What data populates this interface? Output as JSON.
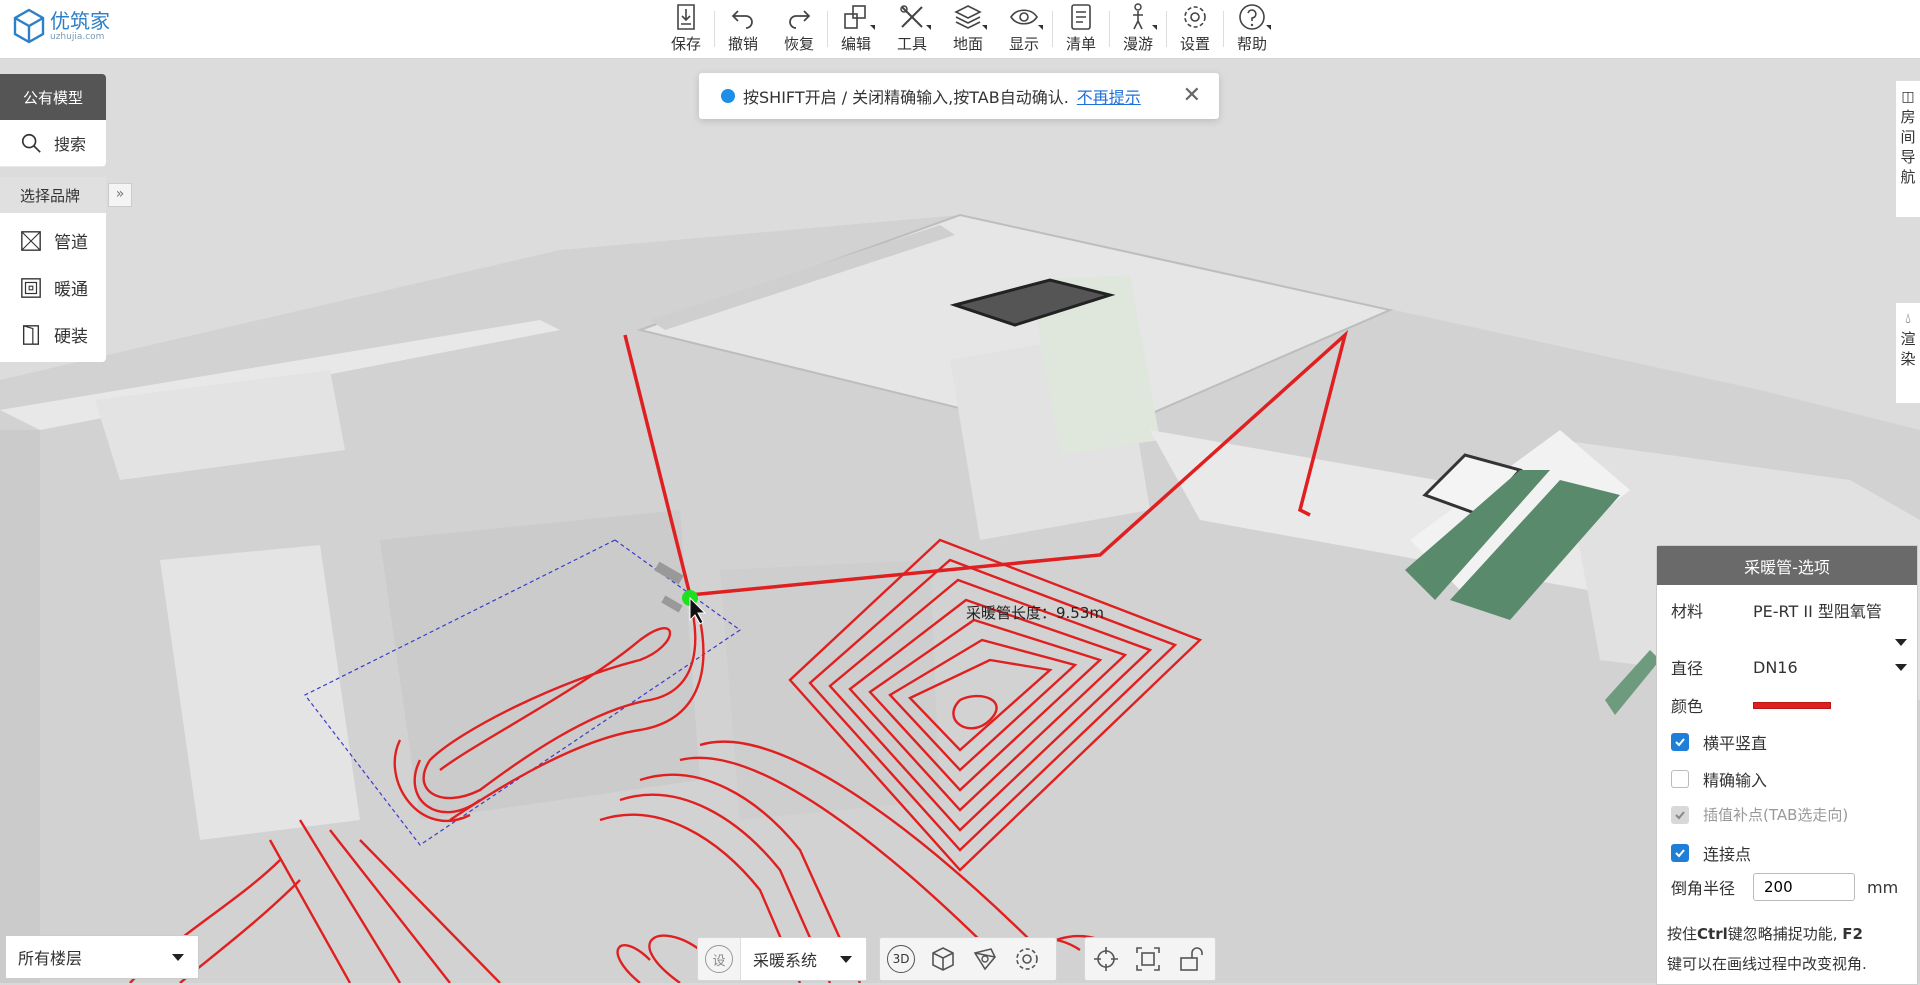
{
  "app": {
    "logo_name": "优筑家",
    "logo_domain": "uzhujia.com"
  },
  "toolbar": {
    "items": [
      {
        "label": "保存",
        "icon": "save-icon",
        "has_menu": false
      },
      {
        "label": "撤销",
        "icon": "undo-icon",
        "has_menu": false
      },
      {
        "label": "恢复",
        "icon": "redo-icon",
        "has_menu": false
      },
      {
        "label": "编辑",
        "icon": "edit-icon",
        "has_menu": true
      },
      {
        "label": "工具",
        "icon": "tools-icon",
        "has_menu": true
      },
      {
        "label": "地面",
        "icon": "layers-icon",
        "has_menu": true
      },
      {
        "label": "显示",
        "icon": "eye-icon",
        "has_menu": true
      },
      {
        "label": "清单",
        "icon": "list-icon",
        "has_menu": false
      },
      {
        "label": "漫游",
        "icon": "walk-icon",
        "has_menu": true
      },
      {
        "label": "设置",
        "icon": "gear-icon",
        "has_menu": false
      },
      {
        "label": "帮助",
        "icon": "help-icon",
        "has_menu": true
      }
    ]
  },
  "hint": {
    "text": "按SHIFT开启 / 关闭精确输入,按TAB自动确认.",
    "link": "不再提示"
  },
  "left_panel": {
    "header": "公有模型",
    "search": "搜索",
    "brand": "选择品牌",
    "items": [
      {
        "label": "管道",
        "icon": "pipe-icon"
      },
      {
        "label": "暖通",
        "icon": "heating-icon"
      },
      {
        "label": "硬装",
        "icon": "door-icon"
      }
    ]
  },
  "side_tabs": {
    "room_nav": [
      "房",
      "间",
      "导",
      "航"
    ],
    "render": [
      "渲",
      "染"
    ]
  },
  "viewport": {
    "pipe_length_label": "采暖管长度：9.53m"
  },
  "options_panel": {
    "title": "采暖管-选项",
    "material_label": "材料",
    "material_value": "PE-RT II 型阻氧管",
    "diameter_label": "直径",
    "diameter_value": "DN16",
    "color_label": "颜色",
    "color_value": "#e02020",
    "checkboxes": [
      {
        "label": "横平竖直",
        "state": "checked"
      },
      {
        "label": "精确输入",
        "state": "unchecked"
      },
      {
        "label": "插值补点(TAB选走向)",
        "state": "disabled-checked"
      },
      {
        "label": "连接点",
        "state": "checked"
      }
    ],
    "radius_label": "倒角半径",
    "radius_value": "200",
    "radius_unit": "mm",
    "tip_prefix": "按住",
    "tip_key1": "Ctrl",
    "tip_mid": "键忽略捕捉功能, ",
    "tip_key2": "F2",
    "tip_line2": "键可以在画线过程中改变视角."
  },
  "bottom": {
    "floor_select": "所有楼层",
    "settings_short": "设",
    "system_select": "采暖系统",
    "view_3d": "3D"
  },
  "colors": {
    "accent": "#1f7fd8",
    "pipe": "#e02020",
    "panel_header": "#6a6a6a",
    "snap_point": "#1fe01f"
  }
}
